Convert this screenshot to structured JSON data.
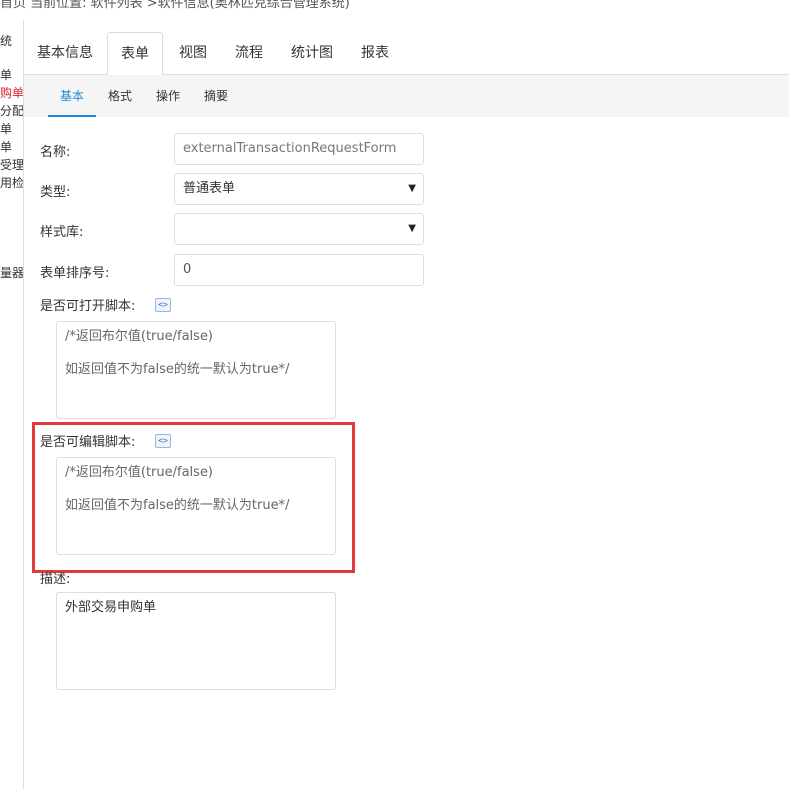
{
  "breadcrumb": "首页  当前位置: 软件列表 >软件信息(奥林匹克综合管理系统)",
  "sidebar": {
    "items": [
      {
        "label": "统",
        "active": false
      },
      {
        "label": "单",
        "active": false
      },
      {
        "label": "购单",
        "active": true
      },
      {
        "label": "分配",
        "active": false
      },
      {
        "label": "单",
        "active": false
      },
      {
        "label": "单",
        "active": false
      },
      {
        "label": "受理",
        "active": false
      },
      {
        "label": "用检",
        "active": false
      },
      {
        "label": "量器",
        "active": false
      }
    ]
  },
  "tabs": [
    "基本信息",
    "表单",
    "视图",
    "流程",
    "统计图",
    "报表"
  ],
  "active_tab": "表单",
  "subtabs": [
    "基本",
    "格式",
    "操作",
    "摘要"
  ],
  "active_subtab": "基本",
  "form": {
    "name_label": "名称:",
    "name_value": "externalTransactionRequestForm",
    "type_label": "类型:",
    "type_value": "普通表单",
    "style_label": "样式库:",
    "style_value": "",
    "order_label": "表单排序号:",
    "order_value": "0",
    "open_script_label": "是否可打开脚本:",
    "open_script_line1": "/*返回布尔值(true/false)",
    "open_script_line2": "如返回值不为false的统一默认为true*/",
    "edit_script_label": "是否可编辑脚本:",
    "edit_script_line1": "/*返回布尔值(true/false)",
    "edit_script_line2": "如返回值不为false的统一默认为true*/",
    "desc_label": "描述:",
    "desc_value": "外部交易申购单"
  },
  "icons": {
    "caret": "caret-down-icon",
    "script": "script-editor-icon"
  },
  "colors": {
    "accent": "#1a8ad6",
    "highlight": "#e0393e",
    "sidebar_active": "#d9262c"
  }
}
